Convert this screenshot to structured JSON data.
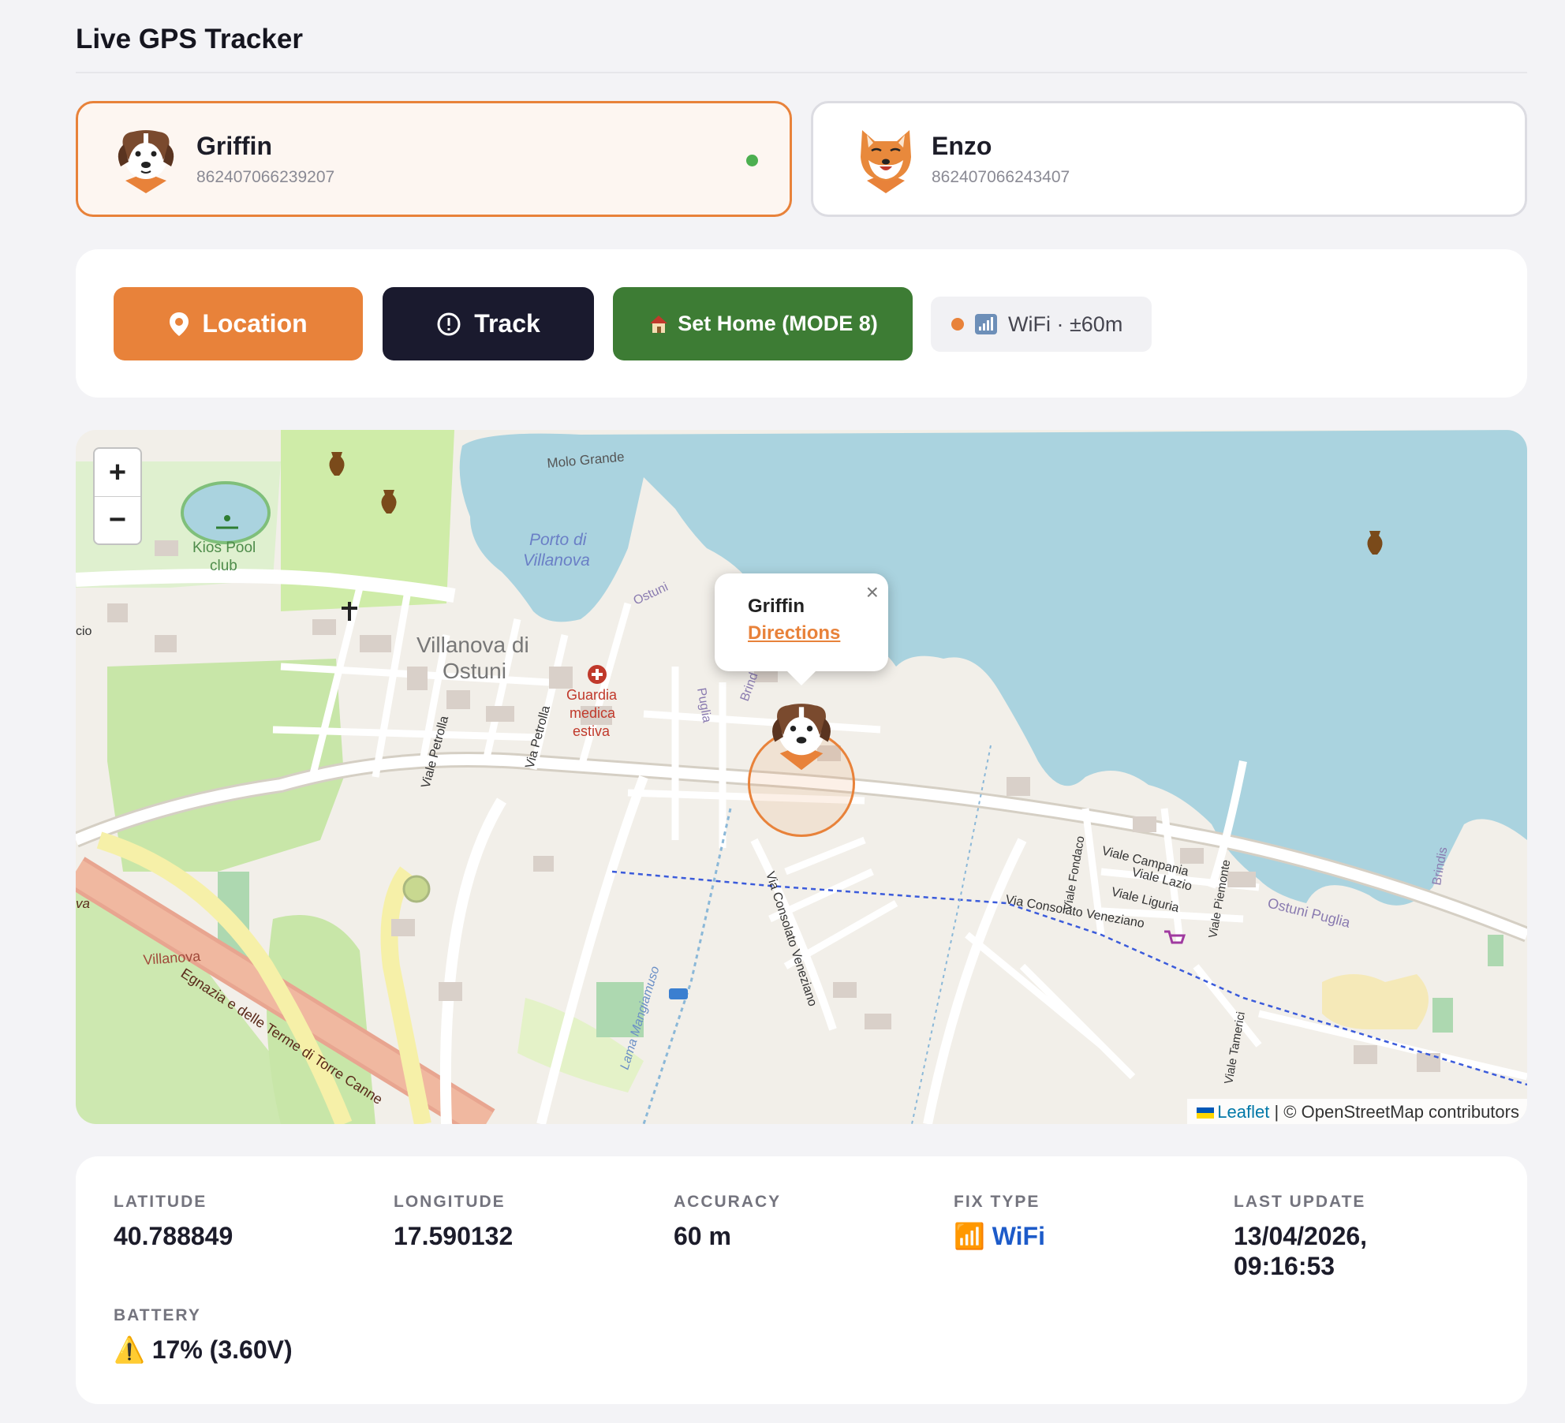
{
  "header": {
    "title": "Live GPS Tracker"
  },
  "dogs": [
    {
      "name": "Griffin",
      "imei": "862407066239207",
      "active": true,
      "online": true,
      "breed_icon": "saint-bernard-icon"
    },
    {
      "name": "Enzo",
      "imei": "862407066243407",
      "active": false,
      "online": false,
      "breed_icon": "shiba-inu-icon"
    }
  ],
  "controls": {
    "location_label": "Location",
    "track_label": "Track",
    "home_label": "Set Home (MODE 8)",
    "fix_status": "WiFi · ±60m",
    "colors": {
      "location": "#e8823a",
      "track": "#1a1a2e",
      "home": "#3d7c34"
    }
  },
  "map": {
    "zoom_in": "+",
    "zoom_out": "−",
    "popup_name": "Griffin",
    "popup_link": "Directions",
    "popup_close": "×",
    "attribution_link": "Leaflet",
    "attribution_text": " | © OpenStreetMap contributors",
    "labels": {
      "molo": "Molo Grande",
      "porto1": "Porto di",
      "porto2": "Villanova",
      "kios1": "Kios Pool",
      "kios2": "club",
      "town1": "Villanova di",
      "town2": "Ostuni",
      "guardia1": "Guardia",
      "guardia2": "medica",
      "guardia3": "estiva",
      "viale_petrolla": "Viale Petrolla",
      "via_petrolla": "Via Petrolla",
      "via_cons1": "Via Consolato Veneziano",
      "via_cons2": "Via Consolato Veneziano",
      "campania": "Viale Campania",
      "lazio": "Viale Lazio",
      "liguria": "Viale Liguria",
      "fondaco": "Viale Fondaco",
      "piemonte": "Viale Piemonte",
      "tamerici": "Viale Tamerici",
      "ostuni_puglia": "Ostuni  Puglia",
      "villanova": "Villanova",
      "egnazia": "Egnazia e delle Terme di Torre Canne",
      "lama": "Lama Mangiamuso",
      "puglia": "Puglia",
      "brindisi": "Brindis",
      "ostuni_small": "Ostuni",
      "cio": "cio",
      "va": "va",
      "brind": "Brind"
    }
  },
  "stats": {
    "latitude_label": "LATITUDE",
    "latitude": "40.788849",
    "longitude_label": "LONGITUDE",
    "longitude": "17.590132",
    "accuracy_label": "ACCURACY",
    "accuracy": "60 m",
    "fix_type_label": "FIX TYPE",
    "fix_type": "📶 WiFi",
    "last_update_label": "LAST UPDATE",
    "last_update_line1": "13/04/2026,",
    "last_update_line2": "09:16:53",
    "battery_label": "BATTERY",
    "battery": "⚠️ 17% (3.60V)"
  }
}
